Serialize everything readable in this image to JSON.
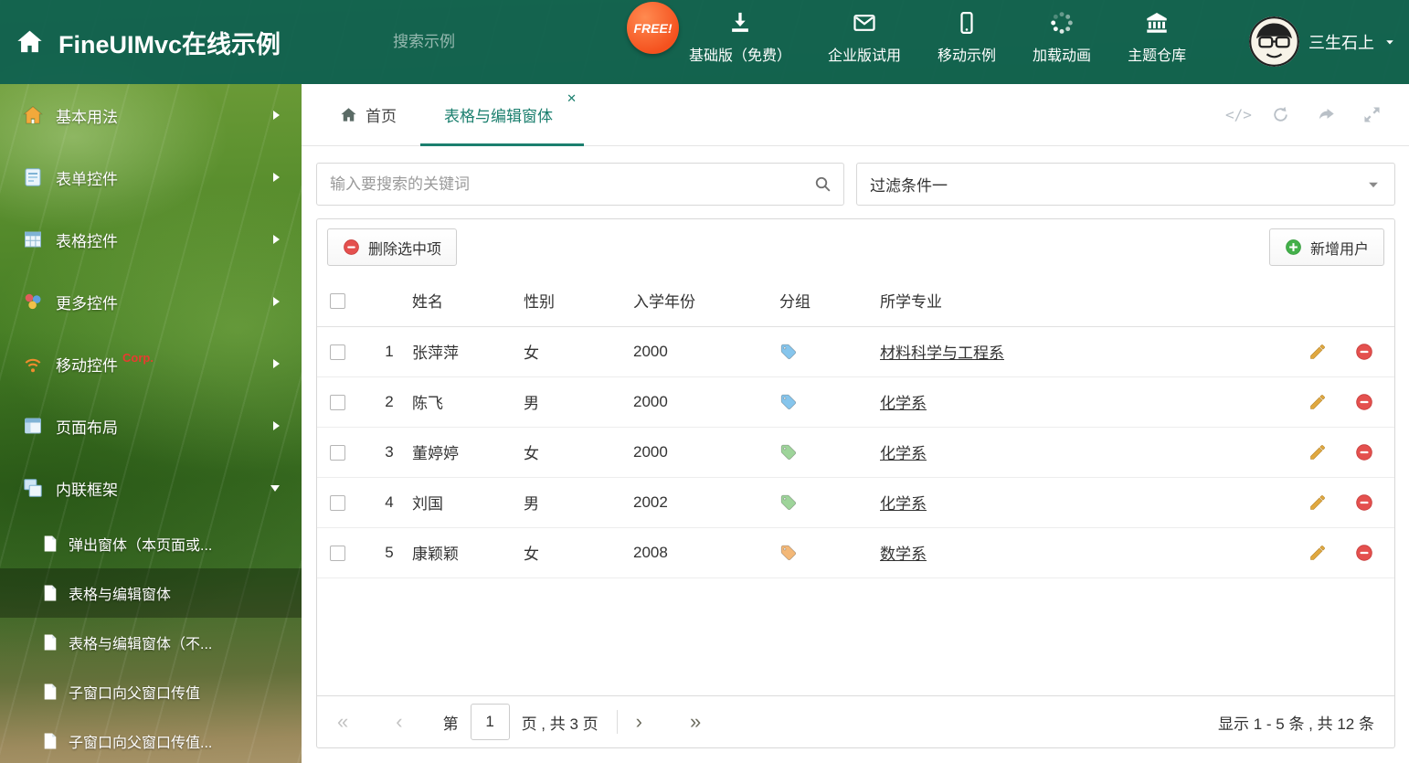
{
  "colors": {
    "accent": "#1b7f6e",
    "free_badge": "#f4511e"
  },
  "header": {
    "title": "FineUIMvc在线示例",
    "search_placeholder": "搜索示例",
    "free_badge": "FREE!",
    "nav_items": [
      {
        "label": "基础版（免费）",
        "icon": "download-icon"
      },
      {
        "label": "企业版试用",
        "icon": "envelope-icon"
      },
      {
        "label": "移动示例",
        "icon": "mobile-icon"
      },
      {
        "label": "加载动画",
        "icon": "spinner-icon"
      },
      {
        "label": "主题仓库",
        "icon": "bank-icon"
      }
    ],
    "username": "三生石上"
  },
  "sidebar": {
    "items": [
      {
        "label": "基本用法",
        "icon": "house-icon"
      },
      {
        "label": "表单控件",
        "icon": "form-icon"
      },
      {
        "label": "表格控件",
        "icon": "grid-icon"
      },
      {
        "label": "更多控件",
        "icon": "shapes-icon"
      },
      {
        "label": "移动控件",
        "icon": "signal-icon",
        "badge": "Corp."
      },
      {
        "label": "页面布局",
        "icon": "layout-icon"
      },
      {
        "label": "内联框架",
        "icon": "frames-icon",
        "expanded": true
      }
    ],
    "subitems": [
      {
        "label": "弹出窗体（本页面或..."
      },
      {
        "label": "表格与编辑窗体",
        "active": true
      },
      {
        "label": "表格与编辑窗体（不..."
      },
      {
        "label": "子窗口向父窗口传值"
      },
      {
        "label": "子窗口向父窗口传值..."
      }
    ]
  },
  "tabs": {
    "home": {
      "label": "首页"
    },
    "active": {
      "label": "表格与编辑窗体"
    }
  },
  "main": {
    "search_placeholder": "输入要搜索的关键词",
    "filter_value": "过滤条件一",
    "toolbar": {
      "delete_label": "删除选中项",
      "add_label": "新增用户"
    },
    "table": {
      "columns": [
        "姓名",
        "性别",
        "入学年份",
        "分组",
        "所学专业"
      ],
      "rows": [
        {
          "num": "1",
          "name": "张萍萍",
          "gender": "女",
          "year": "2000",
          "tag_color": "#86c5ec",
          "major": "材料科学与工程系"
        },
        {
          "num": "2",
          "name": "陈飞",
          "gender": "男",
          "year": "2000",
          "tag_color": "#86c5ec",
          "major": "化学系"
        },
        {
          "num": "3",
          "name": "董婷婷",
          "gender": "女",
          "year": "2000",
          "tag_color": "#9ed49a",
          "major": "化学系"
        },
        {
          "num": "4",
          "name": "刘国",
          "gender": "男",
          "year": "2002",
          "tag_color": "#9ed49a",
          "major": "化学系"
        },
        {
          "num": "5",
          "name": "康颖颖",
          "gender": "女",
          "year": "2008",
          "tag_color": "#f3b878",
          "major": "数学系"
        }
      ]
    },
    "pagination": {
      "page_prefix": "第",
      "current_page": "1",
      "page_suffix": "页 , 共 3 页",
      "summary": "显示 1 - 5 条 , 共 12 条"
    }
  }
}
